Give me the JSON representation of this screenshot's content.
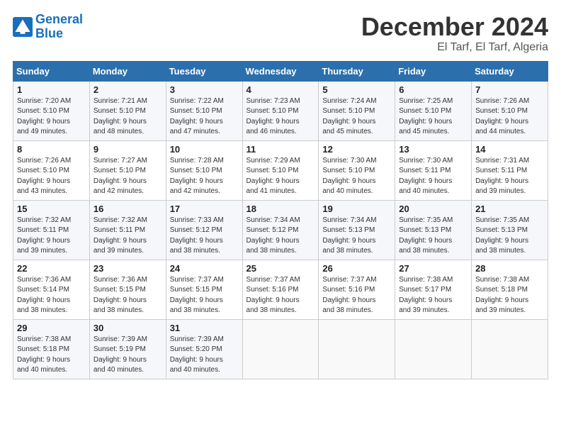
{
  "logo": {
    "line1": "General",
    "line2": "Blue"
  },
  "title": "December 2024",
  "location": "El Tarf, El Tarf, Algeria",
  "headers": [
    "Sunday",
    "Monday",
    "Tuesday",
    "Wednesday",
    "Thursday",
    "Friday",
    "Saturday"
  ],
  "weeks": [
    [
      {
        "day": "1",
        "info": "Sunrise: 7:20 AM\nSunset: 5:10 PM\nDaylight: 9 hours\nand 49 minutes."
      },
      {
        "day": "2",
        "info": "Sunrise: 7:21 AM\nSunset: 5:10 PM\nDaylight: 9 hours\nand 48 minutes."
      },
      {
        "day": "3",
        "info": "Sunrise: 7:22 AM\nSunset: 5:10 PM\nDaylight: 9 hours\nand 47 minutes."
      },
      {
        "day": "4",
        "info": "Sunrise: 7:23 AM\nSunset: 5:10 PM\nDaylight: 9 hours\nand 46 minutes."
      },
      {
        "day": "5",
        "info": "Sunrise: 7:24 AM\nSunset: 5:10 PM\nDaylight: 9 hours\nand 45 minutes."
      },
      {
        "day": "6",
        "info": "Sunrise: 7:25 AM\nSunset: 5:10 PM\nDaylight: 9 hours\nand 45 minutes."
      },
      {
        "day": "7",
        "info": "Sunrise: 7:26 AM\nSunset: 5:10 PM\nDaylight: 9 hours\nand 44 minutes."
      }
    ],
    [
      {
        "day": "8",
        "info": "Sunrise: 7:26 AM\nSunset: 5:10 PM\nDaylight: 9 hours\nand 43 minutes."
      },
      {
        "day": "9",
        "info": "Sunrise: 7:27 AM\nSunset: 5:10 PM\nDaylight: 9 hours\nand 42 minutes."
      },
      {
        "day": "10",
        "info": "Sunrise: 7:28 AM\nSunset: 5:10 PM\nDaylight: 9 hours\nand 42 minutes."
      },
      {
        "day": "11",
        "info": "Sunrise: 7:29 AM\nSunset: 5:10 PM\nDaylight: 9 hours\nand 41 minutes."
      },
      {
        "day": "12",
        "info": "Sunrise: 7:30 AM\nSunset: 5:10 PM\nDaylight: 9 hours\nand 40 minutes."
      },
      {
        "day": "13",
        "info": "Sunrise: 7:30 AM\nSunset: 5:11 PM\nDaylight: 9 hours\nand 40 minutes."
      },
      {
        "day": "14",
        "info": "Sunrise: 7:31 AM\nSunset: 5:11 PM\nDaylight: 9 hours\nand 39 minutes."
      }
    ],
    [
      {
        "day": "15",
        "info": "Sunrise: 7:32 AM\nSunset: 5:11 PM\nDaylight: 9 hours\nand 39 minutes."
      },
      {
        "day": "16",
        "info": "Sunrise: 7:32 AM\nSunset: 5:11 PM\nDaylight: 9 hours\nand 39 minutes."
      },
      {
        "day": "17",
        "info": "Sunrise: 7:33 AM\nSunset: 5:12 PM\nDaylight: 9 hours\nand 38 minutes."
      },
      {
        "day": "18",
        "info": "Sunrise: 7:34 AM\nSunset: 5:12 PM\nDaylight: 9 hours\nand 38 minutes."
      },
      {
        "day": "19",
        "info": "Sunrise: 7:34 AM\nSunset: 5:13 PM\nDaylight: 9 hours\nand 38 minutes."
      },
      {
        "day": "20",
        "info": "Sunrise: 7:35 AM\nSunset: 5:13 PM\nDaylight: 9 hours\nand 38 minutes."
      },
      {
        "day": "21",
        "info": "Sunrise: 7:35 AM\nSunset: 5:13 PM\nDaylight: 9 hours\nand 38 minutes."
      }
    ],
    [
      {
        "day": "22",
        "info": "Sunrise: 7:36 AM\nSunset: 5:14 PM\nDaylight: 9 hours\nand 38 minutes."
      },
      {
        "day": "23",
        "info": "Sunrise: 7:36 AM\nSunset: 5:15 PM\nDaylight: 9 hours\nand 38 minutes."
      },
      {
        "day": "24",
        "info": "Sunrise: 7:37 AM\nSunset: 5:15 PM\nDaylight: 9 hours\nand 38 minutes."
      },
      {
        "day": "25",
        "info": "Sunrise: 7:37 AM\nSunset: 5:16 PM\nDaylight: 9 hours\nand 38 minutes."
      },
      {
        "day": "26",
        "info": "Sunrise: 7:37 AM\nSunset: 5:16 PM\nDaylight: 9 hours\nand 38 minutes."
      },
      {
        "day": "27",
        "info": "Sunrise: 7:38 AM\nSunset: 5:17 PM\nDaylight: 9 hours\nand 39 minutes."
      },
      {
        "day": "28",
        "info": "Sunrise: 7:38 AM\nSunset: 5:18 PM\nDaylight: 9 hours\nand 39 minutes."
      }
    ],
    [
      {
        "day": "29",
        "info": "Sunrise: 7:38 AM\nSunset: 5:18 PM\nDaylight: 9 hours\nand 40 minutes."
      },
      {
        "day": "30",
        "info": "Sunrise: 7:39 AM\nSunset: 5:19 PM\nDaylight: 9 hours\nand 40 minutes."
      },
      {
        "day": "31",
        "info": "Sunrise: 7:39 AM\nSunset: 5:20 PM\nDaylight: 9 hours\nand 40 minutes."
      },
      null,
      null,
      null,
      null
    ]
  ]
}
